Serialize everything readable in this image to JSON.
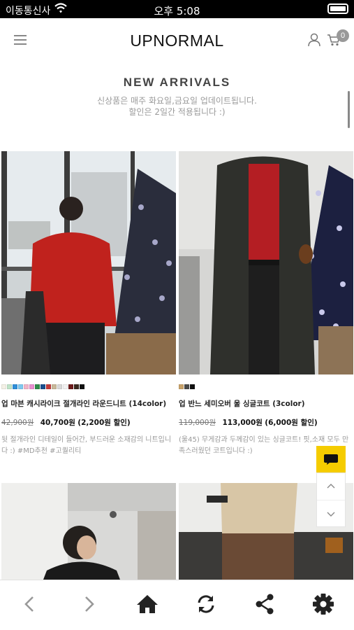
{
  "status_bar": {
    "carrier": "이동통신사",
    "time": "오후 5:08"
  },
  "header": {
    "logo": "UPNORMAL",
    "cart_count": "0"
  },
  "section": {
    "title": "NEW ARRIVALS",
    "desc_line1": "신상품은 매주 화요일,금요일 업데이트됩니다.",
    "desc_line2": "할인은 2일간 적용됩니다 :)"
  },
  "products": [
    {
      "name": "업 마븐 캐시라이크 절개라인 라운드니트 (14color)",
      "original_price": "42,900원",
      "sale_price": "40,700원",
      "discount": "(2,200원 할인)",
      "desc": "뒷 절개라인 디테일이 들어간, 부드러운 소재감의 니트입니다 :) #MD추천 #고퀄리티",
      "swatches": [
        "#f4f1e6",
        "#bfe3c8",
        "#2f8fd8",
        "#7ec8ef",
        "#f0b5c8",
        "#e88fd0",
        "#2f8a4a",
        "#1a4f8e",
        "#c23b3b",
        "#c8b89a",
        "#d8d8d8",
        "#f2f2f2",
        "#6e1c1c",
        "#3a2a20",
        "#111111"
      ]
    },
    {
      "name": "업 반느 세미오버 울 싱글코트 (3color)",
      "original_price": "119,000원",
      "sale_price": "113,000원",
      "discount": "(6,000원 할인)",
      "desc": "(울45) 무게감과 두께감이 있는 싱글코트! 핏,소재 모두 만족스러웠던 코트입니다 :)",
      "swatches": [
        "#c8a26a",
        "#4a4a4a",
        "#111111"
      ]
    }
  ]
}
